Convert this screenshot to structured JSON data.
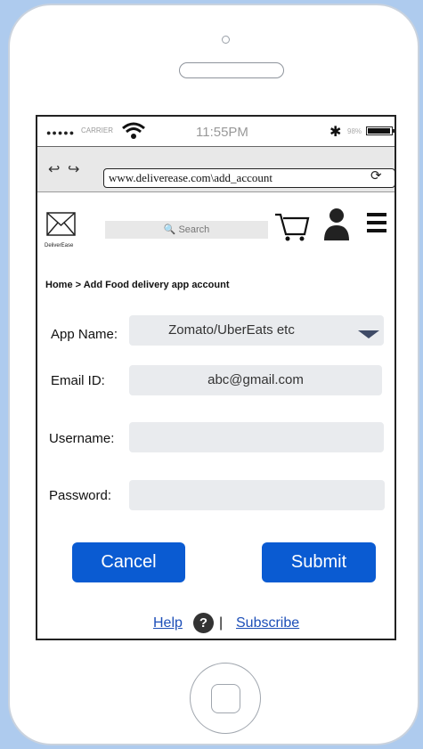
{
  "status_bar": {
    "signal": "●●●●●",
    "carrier": "CARRIER",
    "time": "11:55PM",
    "battery_pct": "98%",
    "battery_level": 0.98,
    "icons": [
      "wifi-icon",
      "bluetooth-icon",
      "battery-icon"
    ]
  },
  "browser": {
    "url": "www.deliverease.com\\add_account",
    "back_glyph": "↩",
    "forward_glyph": "↪",
    "reload_glyph": "⟳"
  },
  "nav": {
    "logo_text": "DeliverEase",
    "search_placeholder": "🔍 Search",
    "icons": [
      "mail-logo-icon",
      "cart-icon",
      "user-icon",
      "hamburger-menu-icon"
    ]
  },
  "breadcrumb": "Home > Add  Food delivery app account",
  "form": {
    "app_name_label": "App Name:",
    "app_name_value": "Zomato/UberEats etc",
    "email_label": "Email ID:",
    "email_value": "abc@gmail.com",
    "username_label": "Username:",
    "username_value": "",
    "password_label": "Password:",
    "password_value": ""
  },
  "buttons": {
    "cancel": "Cancel",
    "submit": "Submit"
  },
  "footer": {
    "help": "Help",
    "help_icon": "?",
    "separator": "|",
    "subscribe": "Subscribe"
  },
  "colors": {
    "background": "#aecbee",
    "primary_button": "#0a5bd2",
    "link": "#1d4fb8",
    "field": "#e9ebee"
  }
}
